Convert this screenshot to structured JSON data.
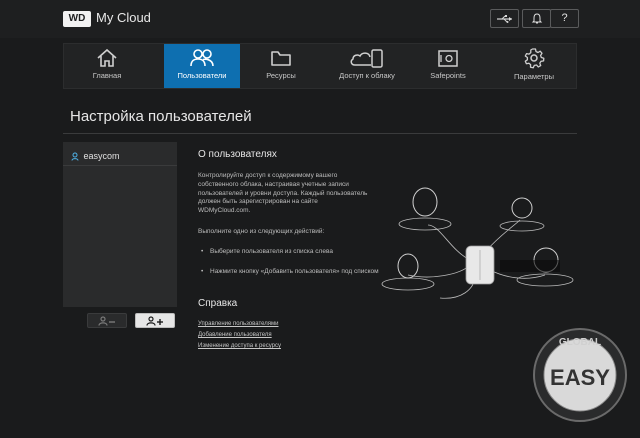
{
  "header": {
    "logo": "WD",
    "app_name": "My Cloud",
    "usb_label": "⇌",
    "bell_label": "🔔",
    "help_label": "?"
  },
  "nav": {
    "items": [
      {
        "label": "Главная",
        "icon": "home-icon"
      },
      {
        "label": "Пользователи",
        "icon": "users-icon",
        "active": true
      },
      {
        "label": "Ресурсы",
        "icon": "folder-icon"
      },
      {
        "label": "Доступ к облаку",
        "icon": "cloud-phone-icon"
      },
      {
        "label": "Safepoints",
        "icon": "safe-icon"
      },
      {
        "label": "Параметры",
        "icon": "gear-icon"
      }
    ]
  },
  "page": {
    "title": "Настройка пользователей"
  },
  "users": {
    "items": [
      {
        "name": "easycom"
      }
    ]
  },
  "about": {
    "title": "О пользователях",
    "paragraph1": "Контролируйте доступ к содержимому вашего собственного облака, настраивая учетные записи пользователей и уровни доступа. Каждый пользователь должен быть зарегистрирован на сайте WDMyCloud.com.",
    "paragraph2": "Выполните одно из следующих действий:",
    "bullet1": "Выберите пользователя из списка слева",
    "bullet2": "Нажмите кнопку «Добавить пользователя» под списком"
  },
  "help": {
    "title": "Справка",
    "links": [
      "Управление пользователями",
      "Добавление пользователя",
      "Изменение доступа к ресурсу"
    ]
  },
  "watermark": {
    "text1": "GLOBAL",
    "text2": "EASY"
  },
  "colors": {
    "accent": "#0e6fb0",
    "background": "#1a1b1c"
  }
}
